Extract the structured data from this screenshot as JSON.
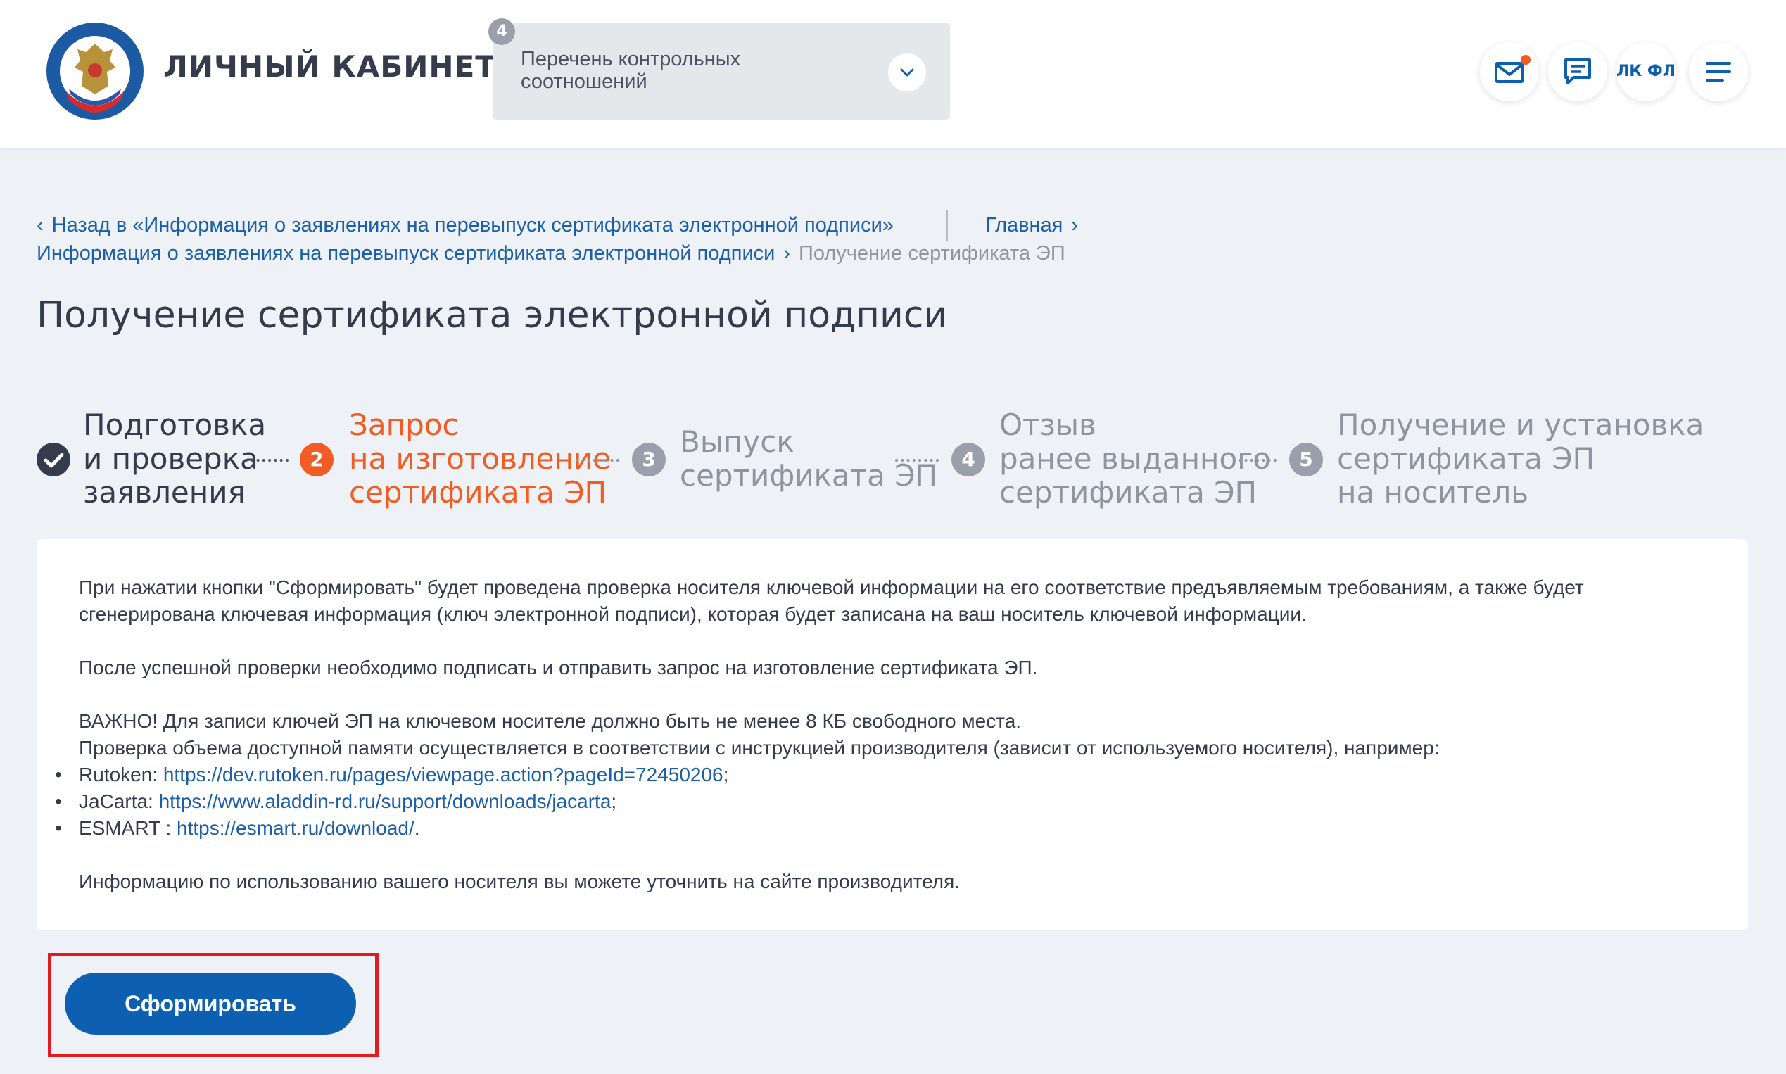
{
  "header": {
    "brand": "ЛИЧНЫЙ КАБИНЕТ ИП",
    "control_list": {
      "badge": "4",
      "label": "Перечень контрольных соотношений"
    },
    "lkfl_label": "ЛК ФЛ",
    "icons": [
      "logo-emblem",
      "mail-icon",
      "chat-icon",
      "menu-icon",
      "chevron-down-icon"
    ]
  },
  "breadcrumbs": {
    "back": "Назад в «Информация о заявлениях на перевыпуск сертификата электронной подписи»",
    "home": "Главная",
    "parent": "Информация о заявлениях на перевыпуск сертификата электронной подписи",
    "current": "Получение сертификата ЭП"
  },
  "page_title": "Получение сертификата электронной подписи",
  "steps": [
    {
      "number": "✓",
      "line1": "Подготовка",
      "line2": "и проверка",
      "line3": "заявления",
      "state": "done"
    },
    {
      "number": "2",
      "line1": "Запрос",
      "line2": "на изготовление",
      "line3": "сертификата ЭП",
      "state": "active"
    },
    {
      "number": "3",
      "line1": "Выпуск",
      "line2": "сертификата ЭП",
      "state": "pending"
    },
    {
      "number": "4",
      "line1": "Отзыв",
      "line2": "ранее выданного",
      "line3": "сертификата ЭП",
      "state": "pending"
    },
    {
      "number": "5",
      "line1": "Получение и установка",
      "line2": "сертификата ЭП",
      "line3": "на носитель",
      "state": "pending"
    }
  ],
  "info": {
    "para1_line1": "При нажатии кнопки \"Сформировать\" будет проведена проверка носителя ключевой информации на его соответствие предъявляемым требованиям, а также будет",
    "para1_line2": "сгенерирована ключевая информация (ключ электронной подписи), которая будет записана на ваш носитель ключевой информации.",
    "para2": "После успешной проверки необходимо подписать и отправить запрос на изготовление сертификата ЭП.",
    "para3": "ВАЖНО! Для записи ключей ЭП на ключевом носителе должно быть не менее 8 КБ свободного места.",
    "para4": "Проверка объема доступной памяти осуществляется в соответствии с инструкцией производителя (зависит от используемого носителя), например:",
    "links": [
      {
        "vendor": "Rutoken: ",
        "url": "https://dev.rutoken.ru/pages/viewpage.action?pageId=72450206",
        "suffix": ";"
      },
      {
        "vendor": "JaCarta: ",
        "url": "https://www.aladdin-rd.ru/support/downloads/jacarta",
        "suffix": ";"
      },
      {
        "vendor": "ESMART : ",
        "url": "https://esmart.ru/download/",
        "suffix": "."
      }
    ],
    "para5": "Информацию по использованию вашего носителя вы можете уточнить на сайте производителя."
  },
  "submit_button": "Сформировать",
  "colors": {
    "accent": "#0d5fb1",
    "active_step": "#f25c23",
    "highlight": "#e21a22"
  }
}
